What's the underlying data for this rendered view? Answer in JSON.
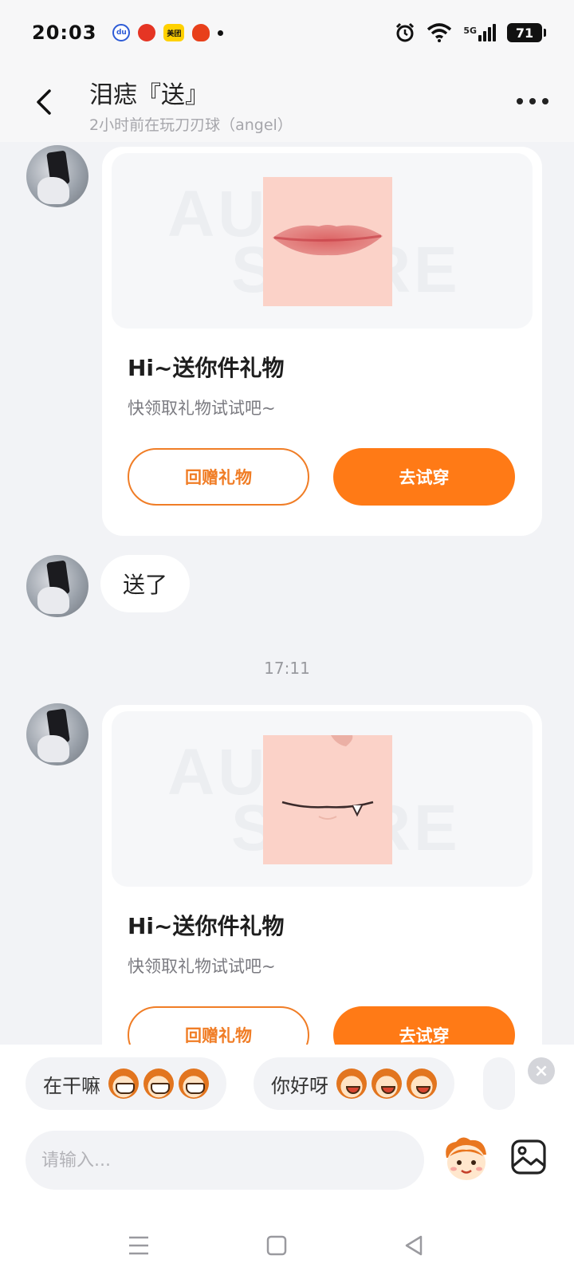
{
  "status_bar": {
    "time": "20:03",
    "apps": [
      "baidu-app-icon",
      "red-app-icon",
      "meituan-app-icon",
      "pinduoduo-app-icon"
    ],
    "meituan_label": "美团",
    "network": "5G",
    "battery": "71"
  },
  "header": {
    "title": "泪痣『送』",
    "subtitle": "2小时前在玩刀刃球（angel）"
  },
  "messages": [
    {
      "type": "gift",
      "title": "Hi~送你件礼物",
      "subtitle": "快领取礼物试试吧~",
      "btn_return": "回赠礼物",
      "btn_try": "去试穿"
    },
    {
      "type": "text",
      "text": "送了"
    },
    {
      "type": "time",
      "text": "17:11"
    },
    {
      "type": "gift",
      "title": "Hi~送你件礼物",
      "subtitle": "快领取礼物试试吧~",
      "btn_return": "回赠礼物",
      "btn_try": "去试穿"
    }
  ],
  "quick_replies": [
    {
      "text": "在干嘛",
      "emoji": "grin-mascot-emoji"
    },
    {
      "text": "你好呀",
      "emoji": "smile-mascot-emoji"
    }
  ],
  "input": {
    "placeholder": "请输入..."
  },
  "colors": {
    "accent": "#ff7a16",
    "background": "#f2f3f6"
  }
}
